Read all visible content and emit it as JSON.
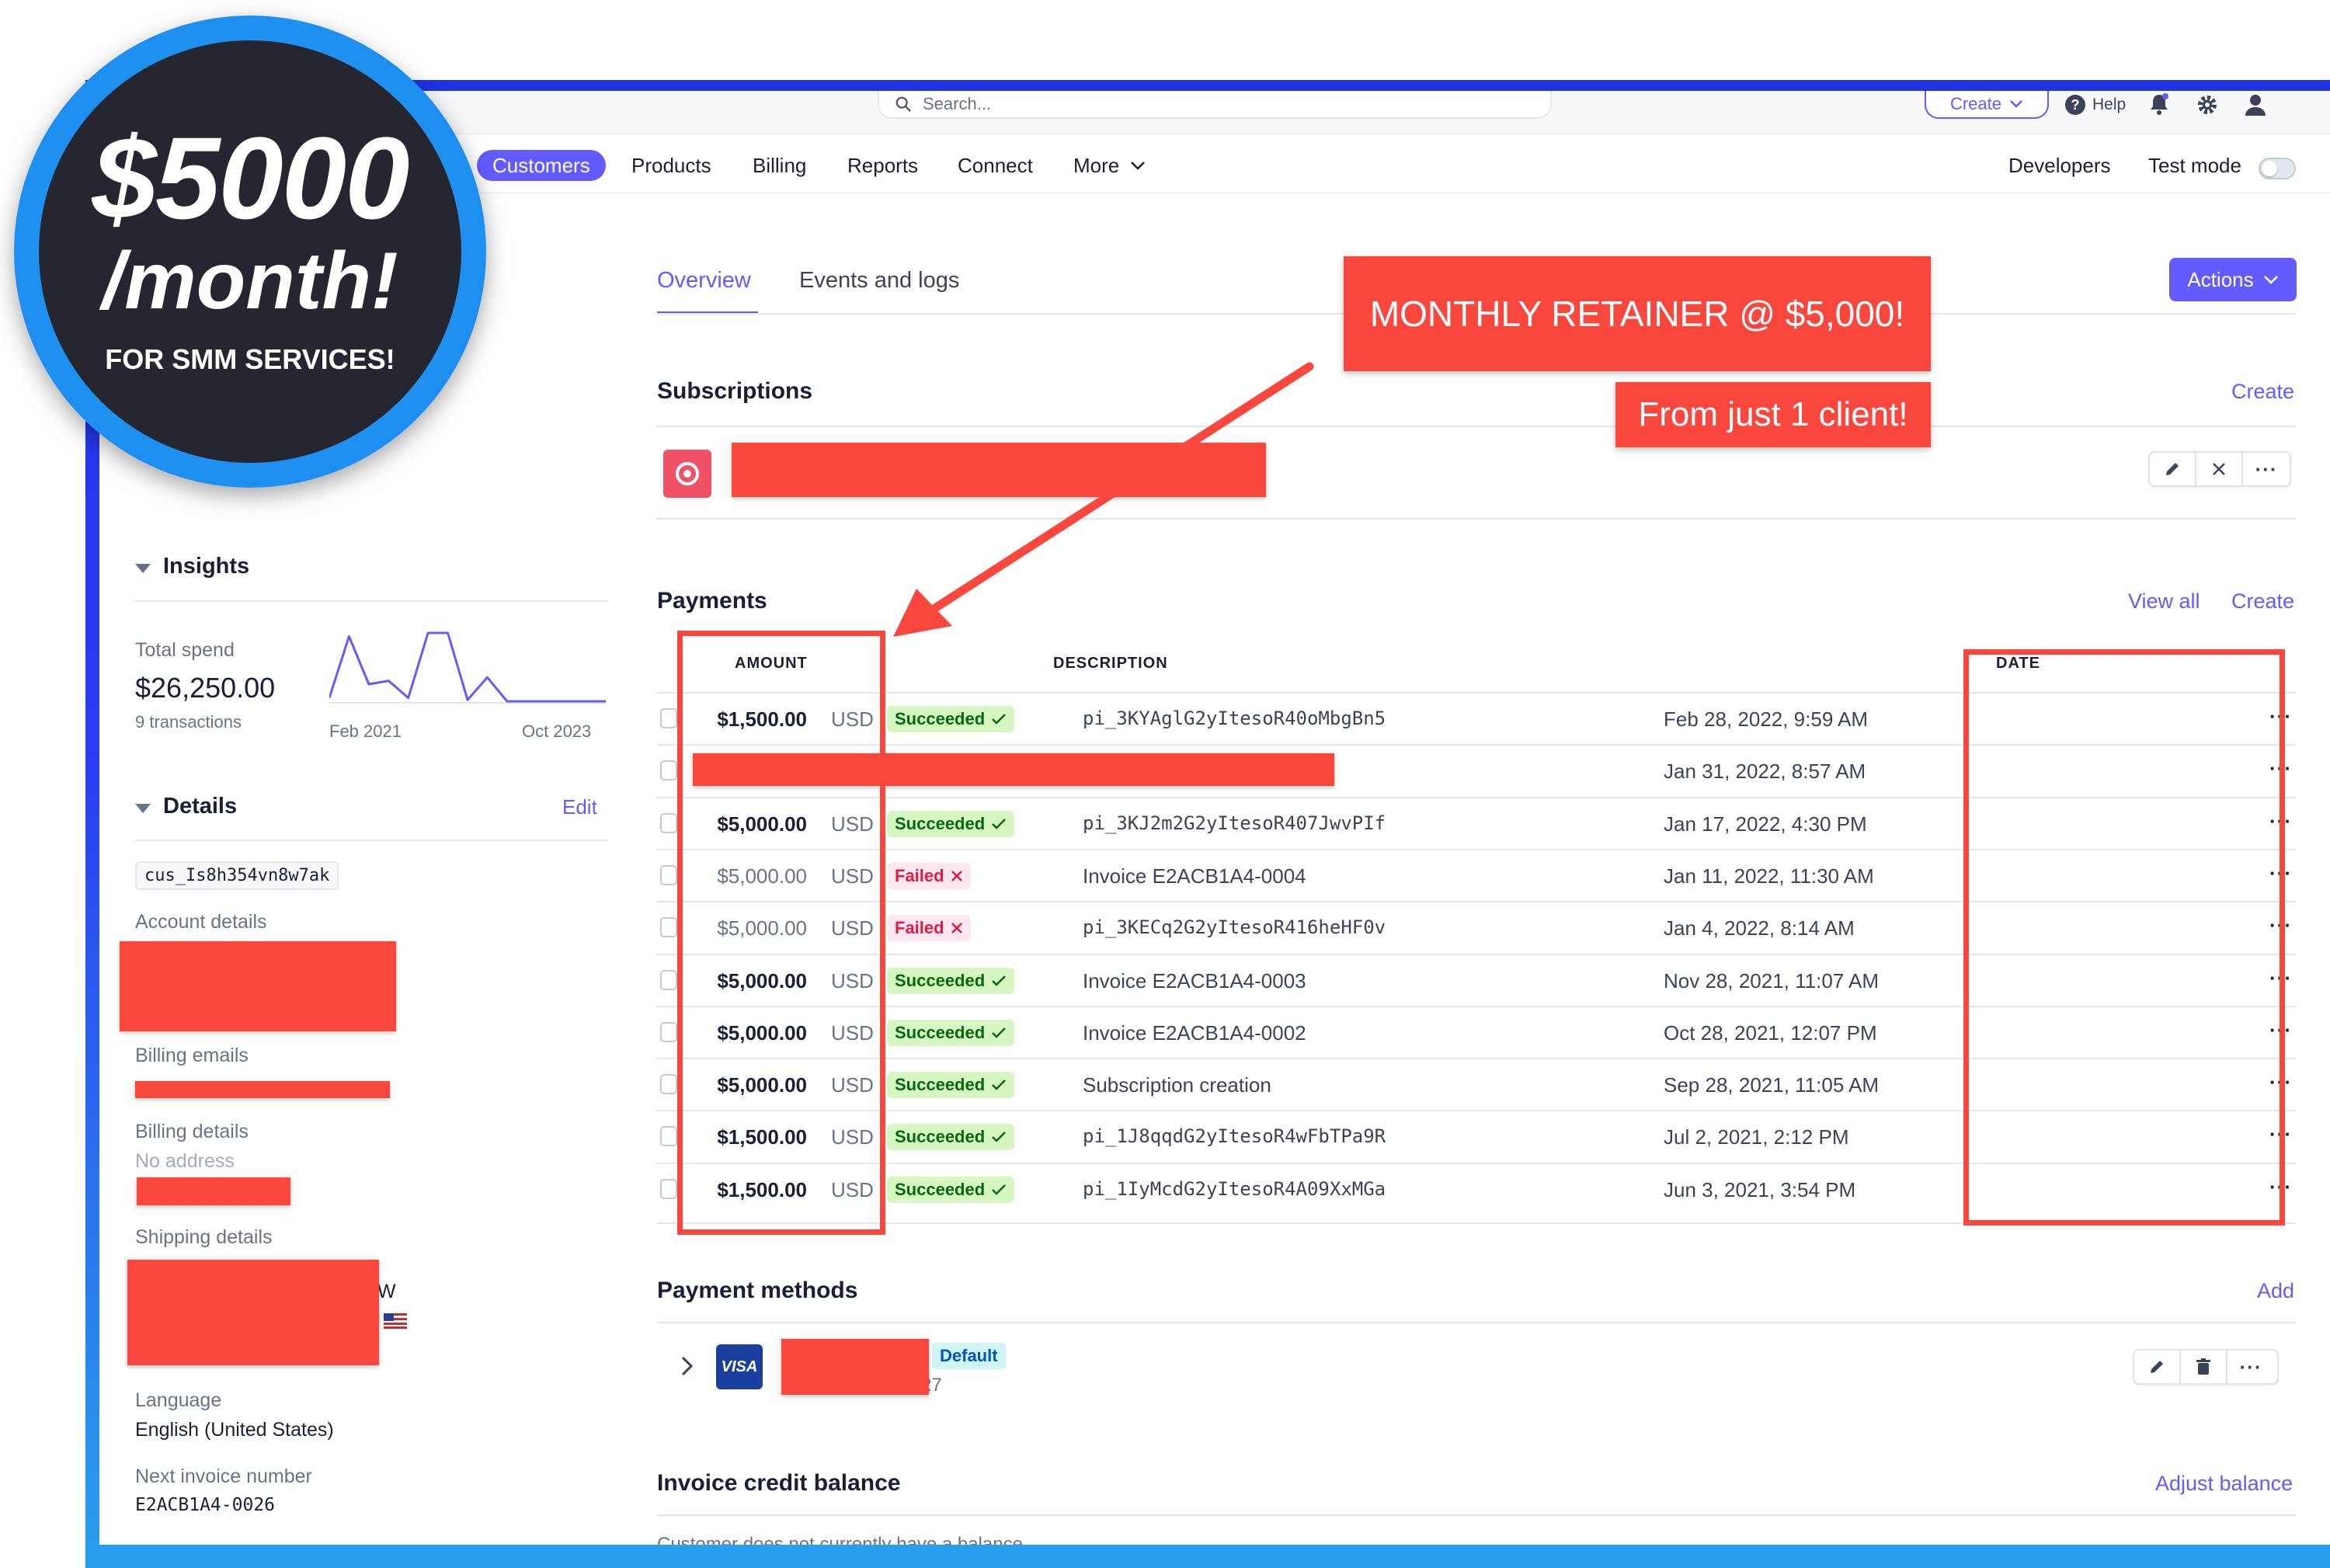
{
  "promo": {
    "amount": "$5000",
    "period": "/month!",
    "tagline": "FOR SMM SERVICES!"
  },
  "callouts": {
    "main": "MONTHLY RETAINER @ $5,000!",
    "sub": "From just 1 client!"
  },
  "topbar": {
    "search_placeholder": "Search...",
    "create_label": "Create",
    "help_label": "Help"
  },
  "nav": {
    "items": [
      "Customers",
      "Products",
      "Billing",
      "Reports",
      "Connect",
      "More"
    ],
    "developers": "Developers",
    "test_mode": "Test mode"
  },
  "tabs": {
    "overview": "Overview",
    "events": "Events and logs",
    "actions": "Actions"
  },
  "subscriptions": {
    "title": "Subscriptions",
    "create": "Create"
  },
  "payments": {
    "title": "Payments",
    "view_all": "View all",
    "create": "Create",
    "headers": {
      "amount": "AMOUNT",
      "description": "DESCRIPTION",
      "date": "DATE"
    },
    "rows": [
      {
        "amount": "$1,500.00",
        "currency": "USD",
        "status": "Succeeded",
        "description": "pi_3KYAglG2yItesoR40oMbgBn5",
        "date": "Feb 28, 2022, 9:59 AM"
      },
      {
        "amount": "",
        "currency": "",
        "status": "",
        "description": "",
        "date": "Jan 31, 2022, 8:57 AM"
      },
      {
        "amount": "$5,000.00",
        "currency": "USD",
        "status": "Succeeded",
        "description": "pi_3KJ2m2G2yItesoR407JwvPIf",
        "date": "Jan 17, 2022, 4:30 PM"
      },
      {
        "amount": "$5,000.00",
        "currency": "USD",
        "status": "Failed",
        "description": "Invoice E2ACB1A4-0004",
        "date": "Jan 11, 2022, 11:30 AM"
      },
      {
        "amount": "$5,000.00",
        "currency": "USD",
        "status": "Failed",
        "description": "pi_3KECq2G2yItesoR416heHF0v",
        "date": "Jan 4, 2022, 8:14 AM"
      },
      {
        "amount": "$5,000.00",
        "currency": "USD",
        "status": "Succeeded",
        "description": "Invoice E2ACB1A4-0003",
        "date": "Nov 28, 2021, 11:07 AM"
      },
      {
        "amount": "$5,000.00",
        "currency": "USD",
        "status": "Succeeded",
        "description": "Invoice E2ACB1A4-0002",
        "date": "Oct 28, 2021, 12:07 PM"
      },
      {
        "amount": "$5,000.00",
        "currency": "USD",
        "status": "Succeeded",
        "description": "Subscription creation",
        "date": "Sep 28, 2021, 11:05 AM"
      },
      {
        "amount": "$1,500.00",
        "currency": "USD",
        "status": "Succeeded",
        "description": "pi_1J8qqdG2yItesoR4wFbTPa9R",
        "date": "Jul 2, 2021, 2:12 PM"
      },
      {
        "amount": "$1,500.00",
        "currency": "USD",
        "status": "Succeeded",
        "description": "pi_1IyMcdG2yItesoR4A09XxMGa",
        "date": "Jun 3, 2021, 3:54 PM"
      }
    ]
  },
  "payment_methods": {
    "title": "Payment methods",
    "add": "Add",
    "card_brand": "VISA",
    "card_tail": "27",
    "default_badge": "Default"
  },
  "credit_balance": {
    "title": "Invoice credit balance",
    "adjust": "Adjust balance",
    "empty_text": "Customer does not currently have a balance."
  },
  "insights": {
    "title": "Insights",
    "total_spend_label": "Total spend",
    "total_spend": "$26,250.00",
    "transactions": "9 transactions",
    "spark_start": "Feb 2021",
    "spark_end": "Oct 2023",
    "sparkline": [
      0.05,
      0.95,
      0.25,
      0.3,
      0.05,
      1.0,
      1.0,
      0.02,
      0.35,
      0.0,
      0.0,
      0.0,
      0.0,
      0.0,
      0.0
    ]
  },
  "details": {
    "title": "Details",
    "edit": "Edit",
    "customer_id": "cus_Is8h354vn8w7ak",
    "account_details": "Account details",
    "billing_emails": "Billing emails",
    "billing_details": "Billing details",
    "no_address": "No address",
    "shipping_details": "Shipping details",
    "shipping_tail": "W",
    "language_label": "Language",
    "language": "English (United States)",
    "next_invoice_label": "Next invoice number",
    "next_invoice": "E2ACB1A4-0026"
  },
  "colors": {
    "accent": "#635bff",
    "redact": "#f9473e",
    "success_bg": "#d7f7c2",
    "fail_bg": "#ffe7f2"
  }
}
